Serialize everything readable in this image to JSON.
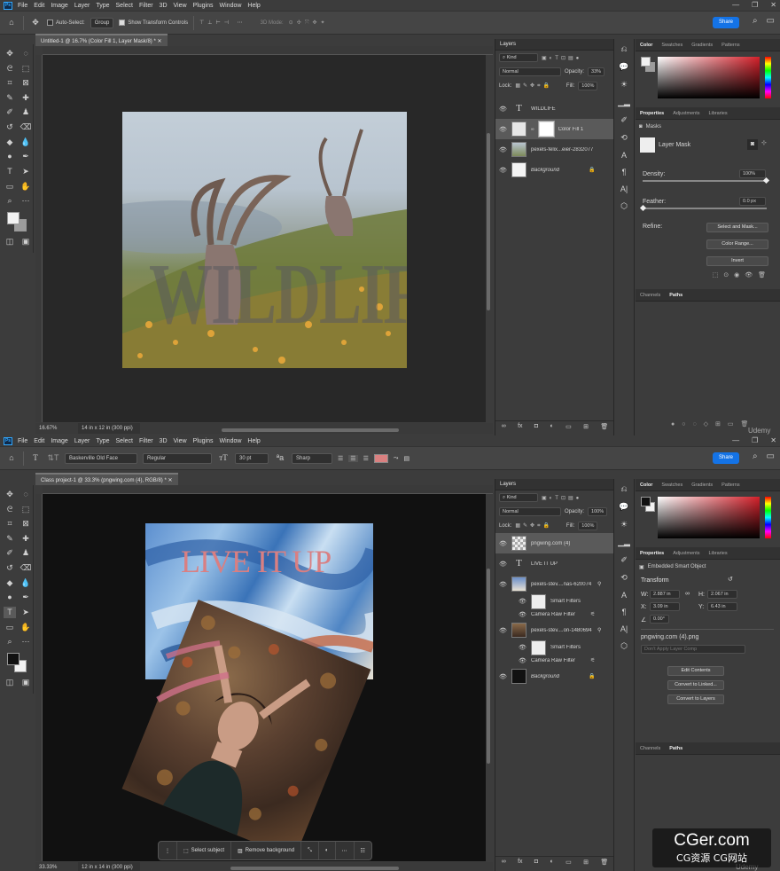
{
  "menu": [
    "File",
    "Edit",
    "Image",
    "Layer",
    "Type",
    "Select",
    "Filter",
    "3D",
    "View",
    "Plugins",
    "Window",
    "Help"
  ],
  "app_icon": "Ps",
  "share_label": "Share",
  "top": {
    "options": {
      "auto_select": "Auto-Select:",
      "group": "Group",
      "transform": "Show Transform Controls",
      "three_d": "3D Mode:"
    },
    "doc_tab": "Untitled-1 @ 16.7% (Color Fill 1, Layer Mask/8) *",
    "canvas_text": "WILDLIFE",
    "zoom": "16.67%",
    "doc_size": "14 in x 12 in (300 ppi)",
    "layers_title": "Layers",
    "kind": "Kind",
    "blend": "Normal",
    "opacity_label": "Opacity:",
    "opacity": "33%",
    "lock_label": "Lock:",
    "fill_label": "Fill:",
    "fill": "100%",
    "layers": [
      {
        "name": "WILDLIFE",
        "type": "text"
      },
      {
        "name": "Color Fill 1",
        "type": "fill",
        "selected": true
      },
      {
        "name": "pexels-felix...eier-2832077",
        "type": "image"
      },
      {
        "name": "Background",
        "type": "bg"
      }
    ],
    "color_tabs": [
      "Color",
      "Swatches",
      "Gradients",
      "Patterns"
    ],
    "prop_tabs": [
      "Properties",
      "Adjustments",
      "Libraries"
    ],
    "masks_label": "Masks",
    "layer_mask_label": "Layer Mask",
    "density_label": "Density:",
    "density": "100%",
    "feather_label": "Feather:",
    "feather": "0.0 px",
    "refine_label": "Refine:",
    "buttons": [
      "Select and Mask...",
      "Color Range...",
      "Invert"
    ],
    "bottom_tabs": [
      "Channels",
      "Paths"
    ],
    "udemy": "Udemy"
  },
  "bottom": {
    "options": {
      "font": "Baskerville Old Face",
      "style": "Regular",
      "size": "30 pt",
      "aa": "Sharp"
    },
    "text_color": "#d98080",
    "doc_tab": "Class project-1 @ 33.3% (pngwing.com (4), RGB/8) *",
    "canvas_text": "LIVE IT UP",
    "zoom": "33.33%",
    "doc_size": "12 in x 14 in (300 ppi)",
    "layers_title": "Layers",
    "kind": "Kind",
    "blend": "Normal",
    "opacity_label": "Opacity:",
    "opacity": "100%",
    "lock_label": "Lock:",
    "fill_label": "Fill:",
    "fill": "100%",
    "layers": [
      {
        "name": "pngwing.com (4)",
        "type": "png",
        "selected": true
      },
      {
        "name": "LIVE IT UP",
        "type": "text"
      },
      {
        "name": "pexels-stev....nas-620074",
        "type": "smart"
      },
      {
        "name": "Smart Filters",
        "type": "filtermask",
        "sub": true
      },
      {
        "name": "Camera Raw Filter",
        "type": "filter",
        "sub": true
      },
      {
        "name": "pexels-stev....on-1480694",
        "type": "smart"
      },
      {
        "name": "Smart Filters",
        "type": "filtermask",
        "sub": true
      },
      {
        "name": "Camera Raw Filter",
        "type": "filter",
        "sub": true
      },
      {
        "name": "Background",
        "type": "bgdark"
      }
    ],
    "color_tabs": [
      "Color",
      "Swatches",
      "Gradients",
      "Patterns"
    ],
    "prop_tabs": [
      "Properties",
      "Adjustments",
      "Libraries"
    ],
    "smart_object_label": "Embedded Smart Object",
    "transform_label": "Transform",
    "w_label": "W:",
    "w": "2.887 in",
    "h_label": "H:",
    "h": "2.067 in",
    "x_label": "X:",
    "x": "3.09 in",
    "y_label": "Y:",
    "y": "6.43 in",
    "angle": "0.00°",
    "file_name": "pngwing.com (4).png",
    "layer_comp": "Don't Apply Layer Comp",
    "buttons": [
      "Edit Contents",
      "Convert to Linked...",
      "Convert to Layers"
    ],
    "bottom_tabs": [
      "Channels",
      "Paths"
    ],
    "ctx": {
      "select_subject": "Select subject",
      "remove_bg": "Remove background"
    },
    "udemy": "Udemy"
  },
  "watermark": {
    "title": "CGer.com",
    "subtitle": "CG资源 CG网站"
  }
}
